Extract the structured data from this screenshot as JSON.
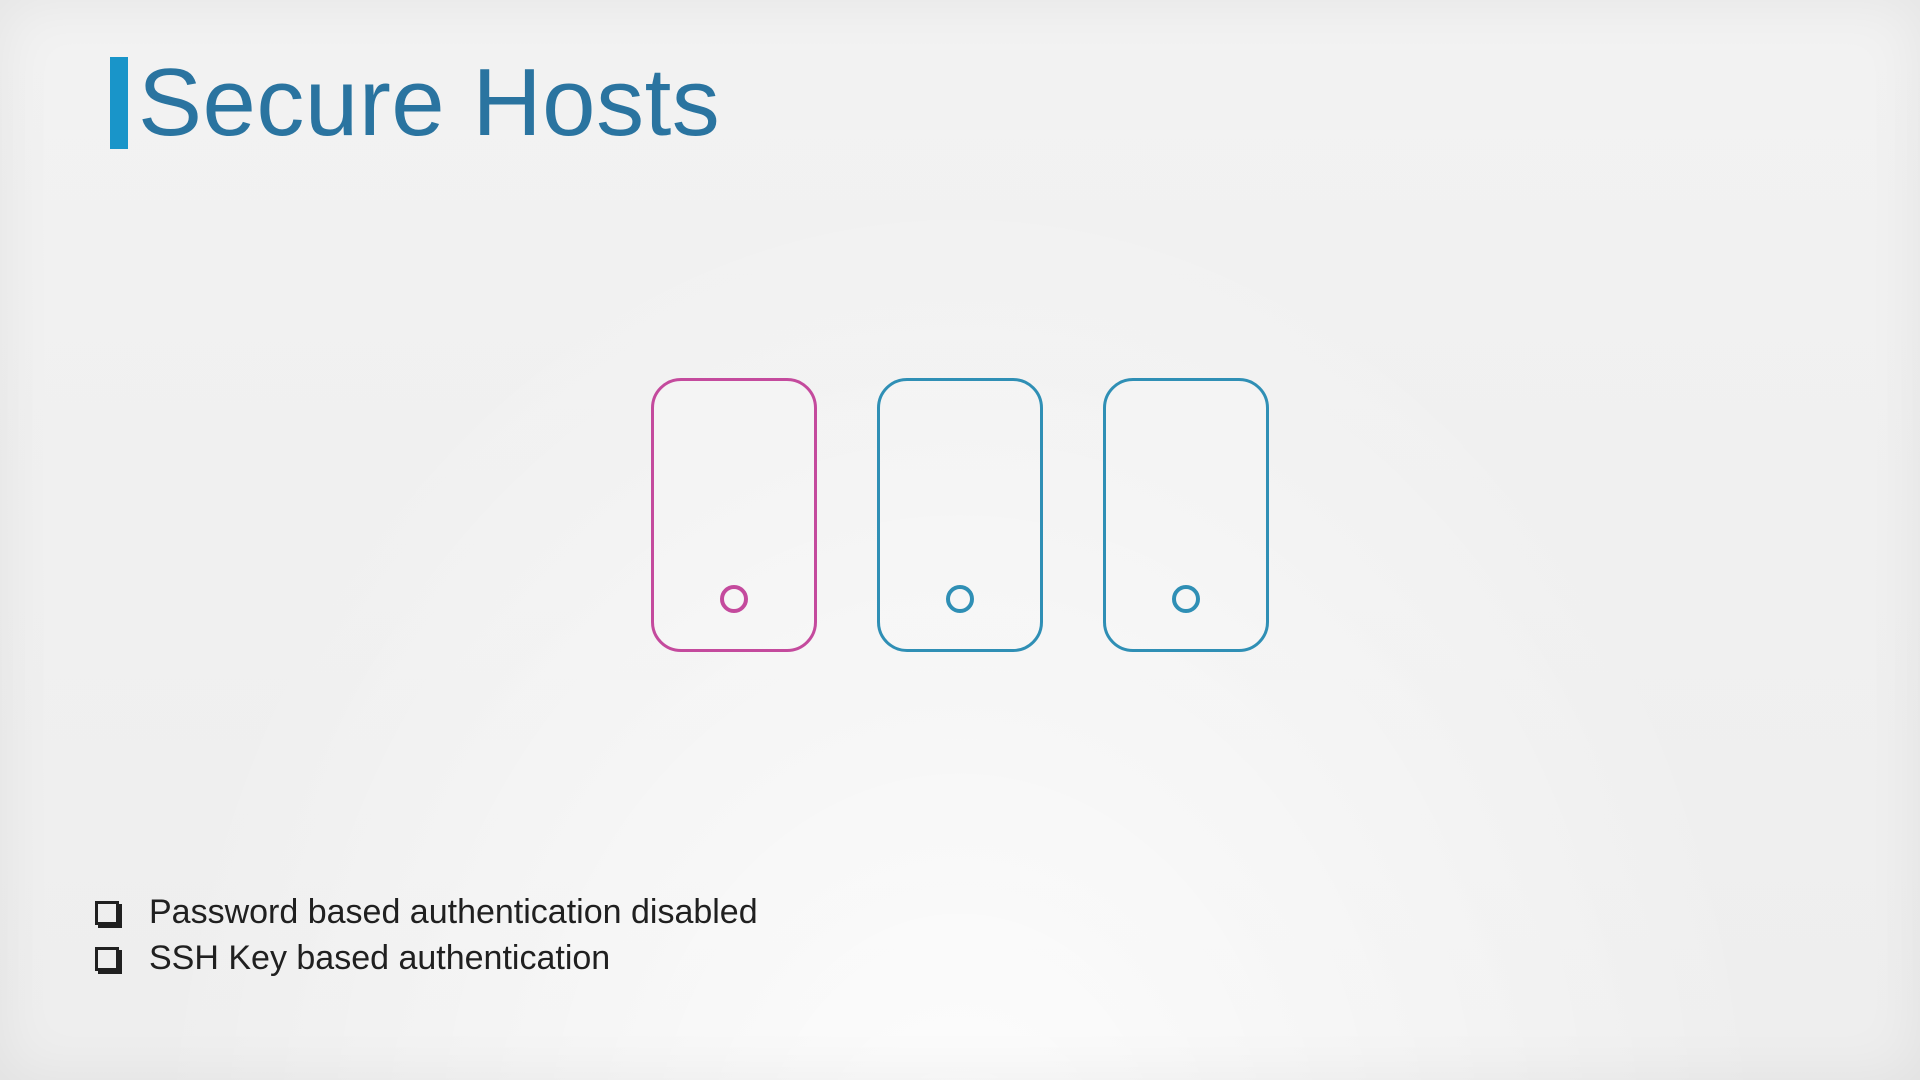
{
  "title": "Secure Hosts",
  "hosts": [
    {
      "variant": "pink"
    },
    {
      "variant": "blue"
    },
    {
      "variant": "blue"
    }
  ],
  "checklist": {
    "items": [
      "Password based authentication disabled",
      "SSH Key based authentication"
    ]
  },
  "colors": {
    "accent_blue": "#2f8fb5",
    "accent_pink": "#c44a9d",
    "title": "#2a74a0"
  }
}
